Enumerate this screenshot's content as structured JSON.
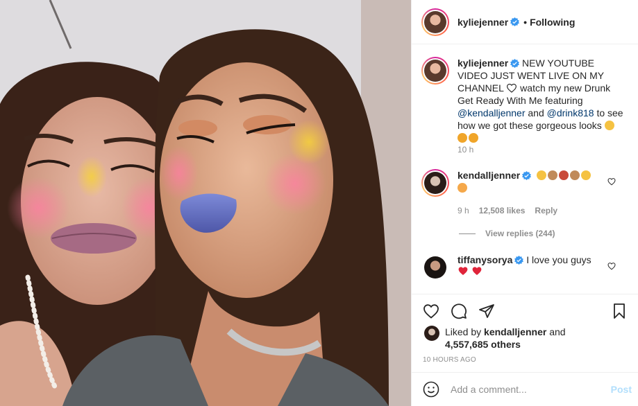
{
  "post": {
    "author": "kyliejenner",
    "follow_status": "Following",
    "caption_author": "kyliejenner",
    "caption_line1": "NEW YOUTUBE VIDEO JUST WENT LIVE ON MY CHANNEL",
    "caption_line2a": " watch my new Drunk Get Ready With Me featuring ",
    "caption_mention1": "@kendalljenner",
    "caption_and": " and ",
    "caption_mention2": "@drink818",
    "caption_line2b": " to see how we got these gorgeous looks",
    "caption_time": "10 h"
  },
  "comments": [
    {
      "user": "kendalljenner",
      "time": "9 h",
      "likes": "12,508 likes",
      "reply_label": "Reply",
      "view_replies": "View replies (244)"
    },
    {
      "user": "tiffanysorya",
      "text": "I love you guys"
    }
  ],
  "likes": {
    "prefix": "Liked by ",
    "user": "kendalljenner",
    "and": " and",
    "others": "4,557,685 others"
  },
  "timestamp": "10 HOURS AGO",
  "comment_box": {
    "placeholder": "Add a comment...",
    "post_label": "Post"
  },
  "colors": {
    "verified": "#3897f0",
    "link": "#00376b",
    "muted": "#8e8e8e",
    "post_disabled": "#b2dffc"
  }
}
